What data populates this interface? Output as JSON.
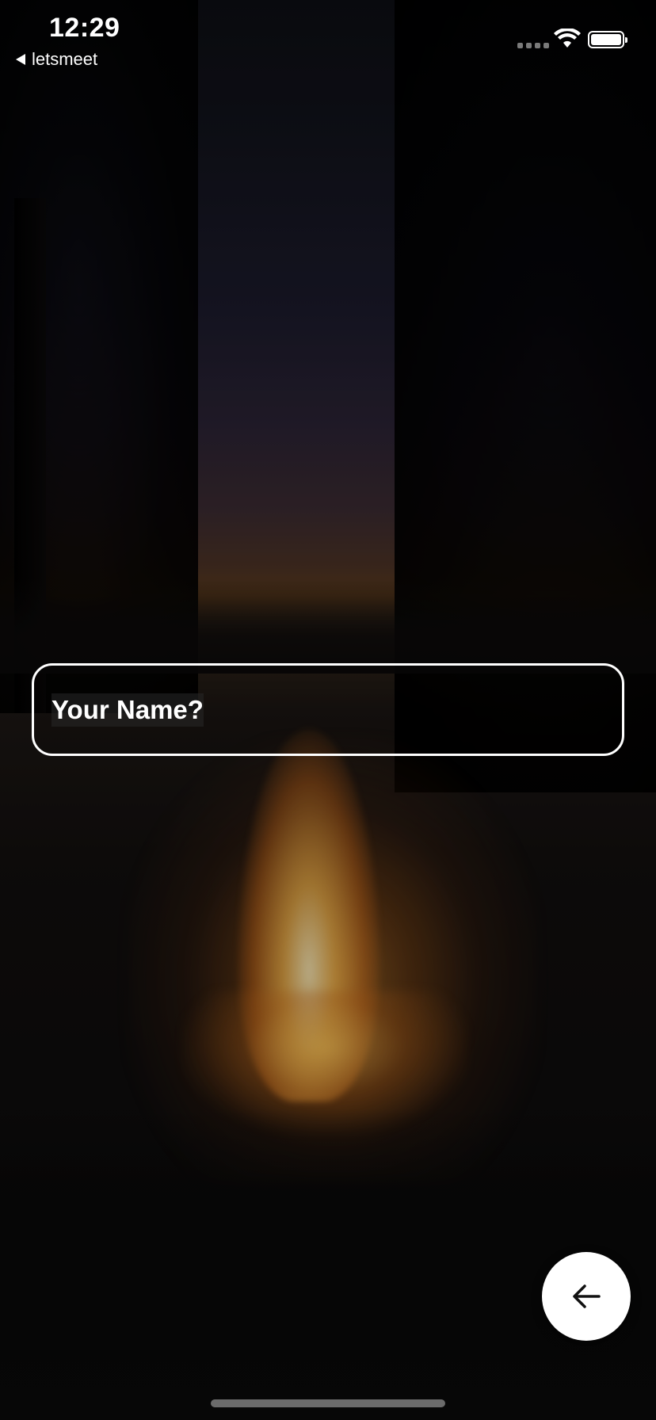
{
  "status_bar": {
    "time": "12:29",
    "back_app_label": "letsmeet",
    "icons": [
      "signal-icon",
      "wifi-icon",
      "battery-icon"
    ]
  },
  "form": {
    "name_placeholder": "Your Name?"
  },
  "actions": {
    "back_button_icon": "arrow-left-icon"
  },
  "colors": {
    "accent": "#ffffff",
    "background": "#0b0b0c",
    "fire_glow": "#ffb43c"
  }
}
